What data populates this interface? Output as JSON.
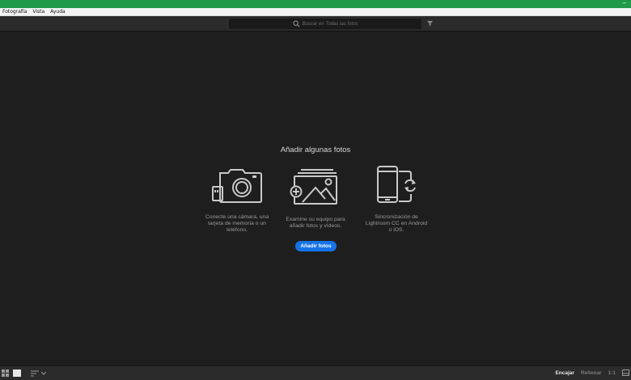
{
  "menu": [
    "Fotografía",
    "Vista",
    "Ayuda"
  ],
  "search": {
    "placeholder": "Buscar en Todas las fotos"
  },
  "empty_state": {
    "title": "Añadir algunas fotos",
    "options": [
      {
        "icon": "camera-icon",
        "lines": [
          "Conecte una cámara, una",
          "tarjeta de memoria o un",
          "teléfono."
        ]
      },
      {
        "icon": "add-photos-icon",
        "lines": [
          "Examine su equipo para",
          "añadir fotos y vídeos."
        ]
      },
      {
        "icon": "mobile-sync-icon",
        "lines": [
          "Sincronización de",
          "Lightroom CC en Android",
          "o iOS."
        ]
      }
    ],
    "button": "Añadir fotos"
  },
  "status": {
    "zoom": [
      "Encajar",
      "Rellenar",
      "1:1"
    ],
    "active_zoom": "Encajar"
  },
  "colors": {
    "titlebar": "#1f9a4a",
    "accent": "#1473e6",
    "background": "#1e1e1e"
  }
}
